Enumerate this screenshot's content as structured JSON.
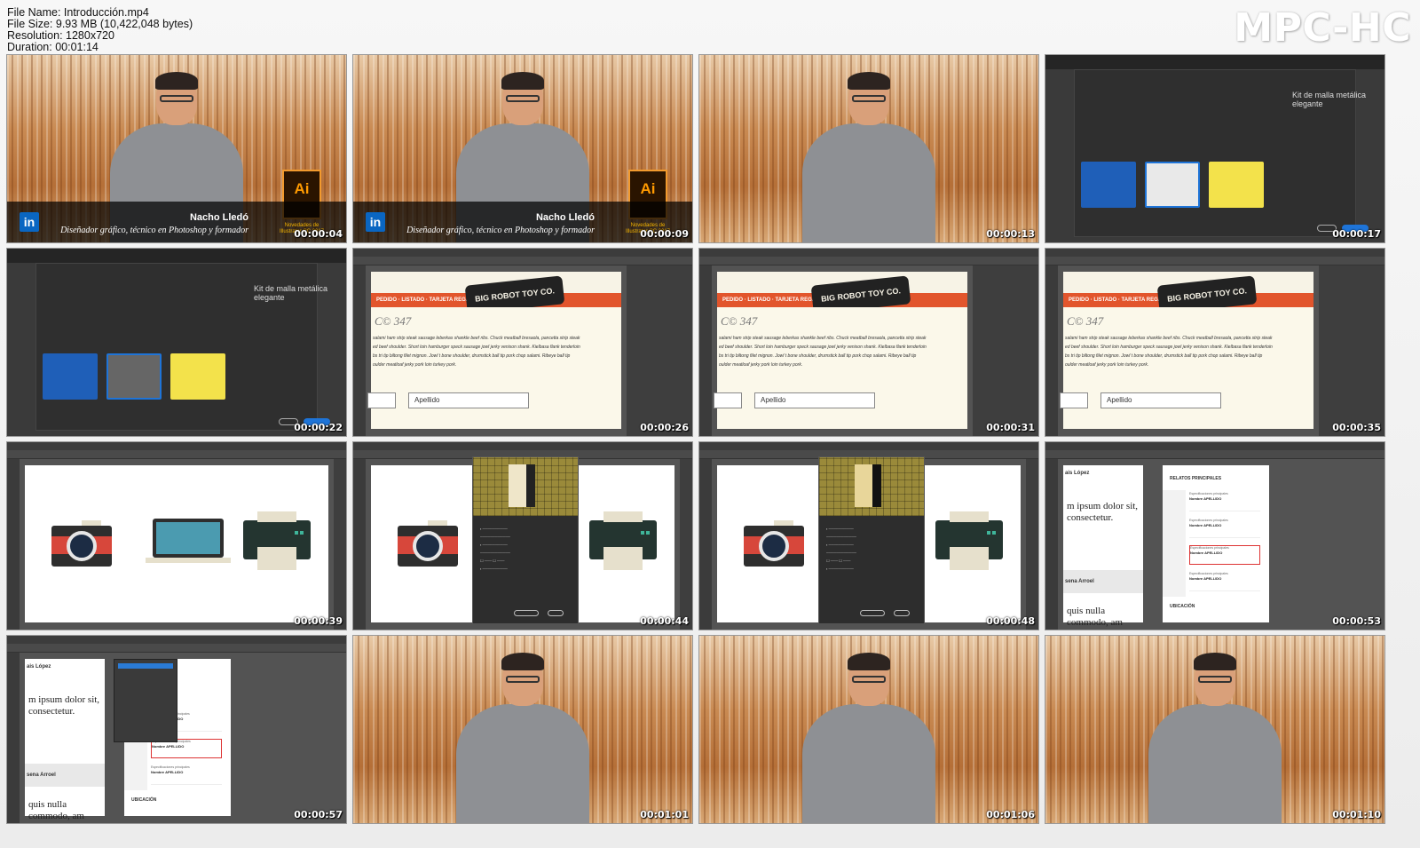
{
  "header": {
    "file_name": "File Name: Introducción.mp4",
    "file_size": "File Size: 9.93 MB (10,422,048 bytes)",
    "resolution": "Resolution: 1280x720",
    "duration": "Duration: 00:01:14"
  },
  "brand": "MPC-HC",
  "thumbnails": [
    {
      "time": "00:00:04"
    },
    {
      "time": "00:00:09"
    },
    {
      "time": "00:00:13"
    },
    {
      "time": "00:00:17"
    },
    {
      "time": "00:00:22"
    },
    {
      "time": "00:00:26"
    },
    {
      "time": "00:00:31"
    },
    {
      "time": "00:00:35"
    },
    {
      "time": "00:00:39"
    },
    {
      "time": "00:00:44"
    },
    {
      "time": "00:00:48"
    },
    {
      "time": "00:00:53"
    },
    {
      "time": "00:00:57"
    },
    {
      "time": "00:01:01"
    },
    {
      "time": "00:01:06"
    },
    {
      "time": "00:01:10"
    }
  ],
  "lower_third": {
    "name": "Nacho Lledó",
    "role": "Diseñador gráfico, técnico en Photoshop y formador",
    "badge": "in",
    "ai_logo": "Ai",
    "ai_caption": "Novedades de Illustrator CC 2017"
  },
  "dialog": {
    "title": "Kit de malla metálica elegante"
  },
  "website": {
    "logo": "BIG ROBOT TOY CO.",
    "nav": "PEDIDO · LISTADO · TARJETA REGALO · AYUDA · CO",
    "number": "C© 347",
    "text_lines": [
      "salami ham strip steak sausage leberkas shankle beef ribs. Chuck meatball bresaola, pancetta strip steak",
      "ed beef shoulder. Short loin hamburger speck sausage jowl jerky venison shank. Kielbasa flank tenderloin",
      "bs tri tip biltong filet mignon. Jowl t bone shoulder, drumstick ball tip pork chop salami. Ribeye ball tip",
      "oulder meatloaf jerky pork loin turkey pork."
    ],
    "field": "Apellido"
  },
  "document": {
    "left_heading": "ais López",
    "left_text_1": "m ipsum dolor sit, consectetur.",
    "left_heading_2": "sena Arroel",
    "left_text_2": "quis nulla commodo, am lectus sed.",
    "right_heading": "RELATOS PRINCIPALES",
    "right_heading_2": "UBICACIÓN",
    "item_title": "Nombre APELLIDO",
    "item_text": "Especificaciones principales"
  }
}
